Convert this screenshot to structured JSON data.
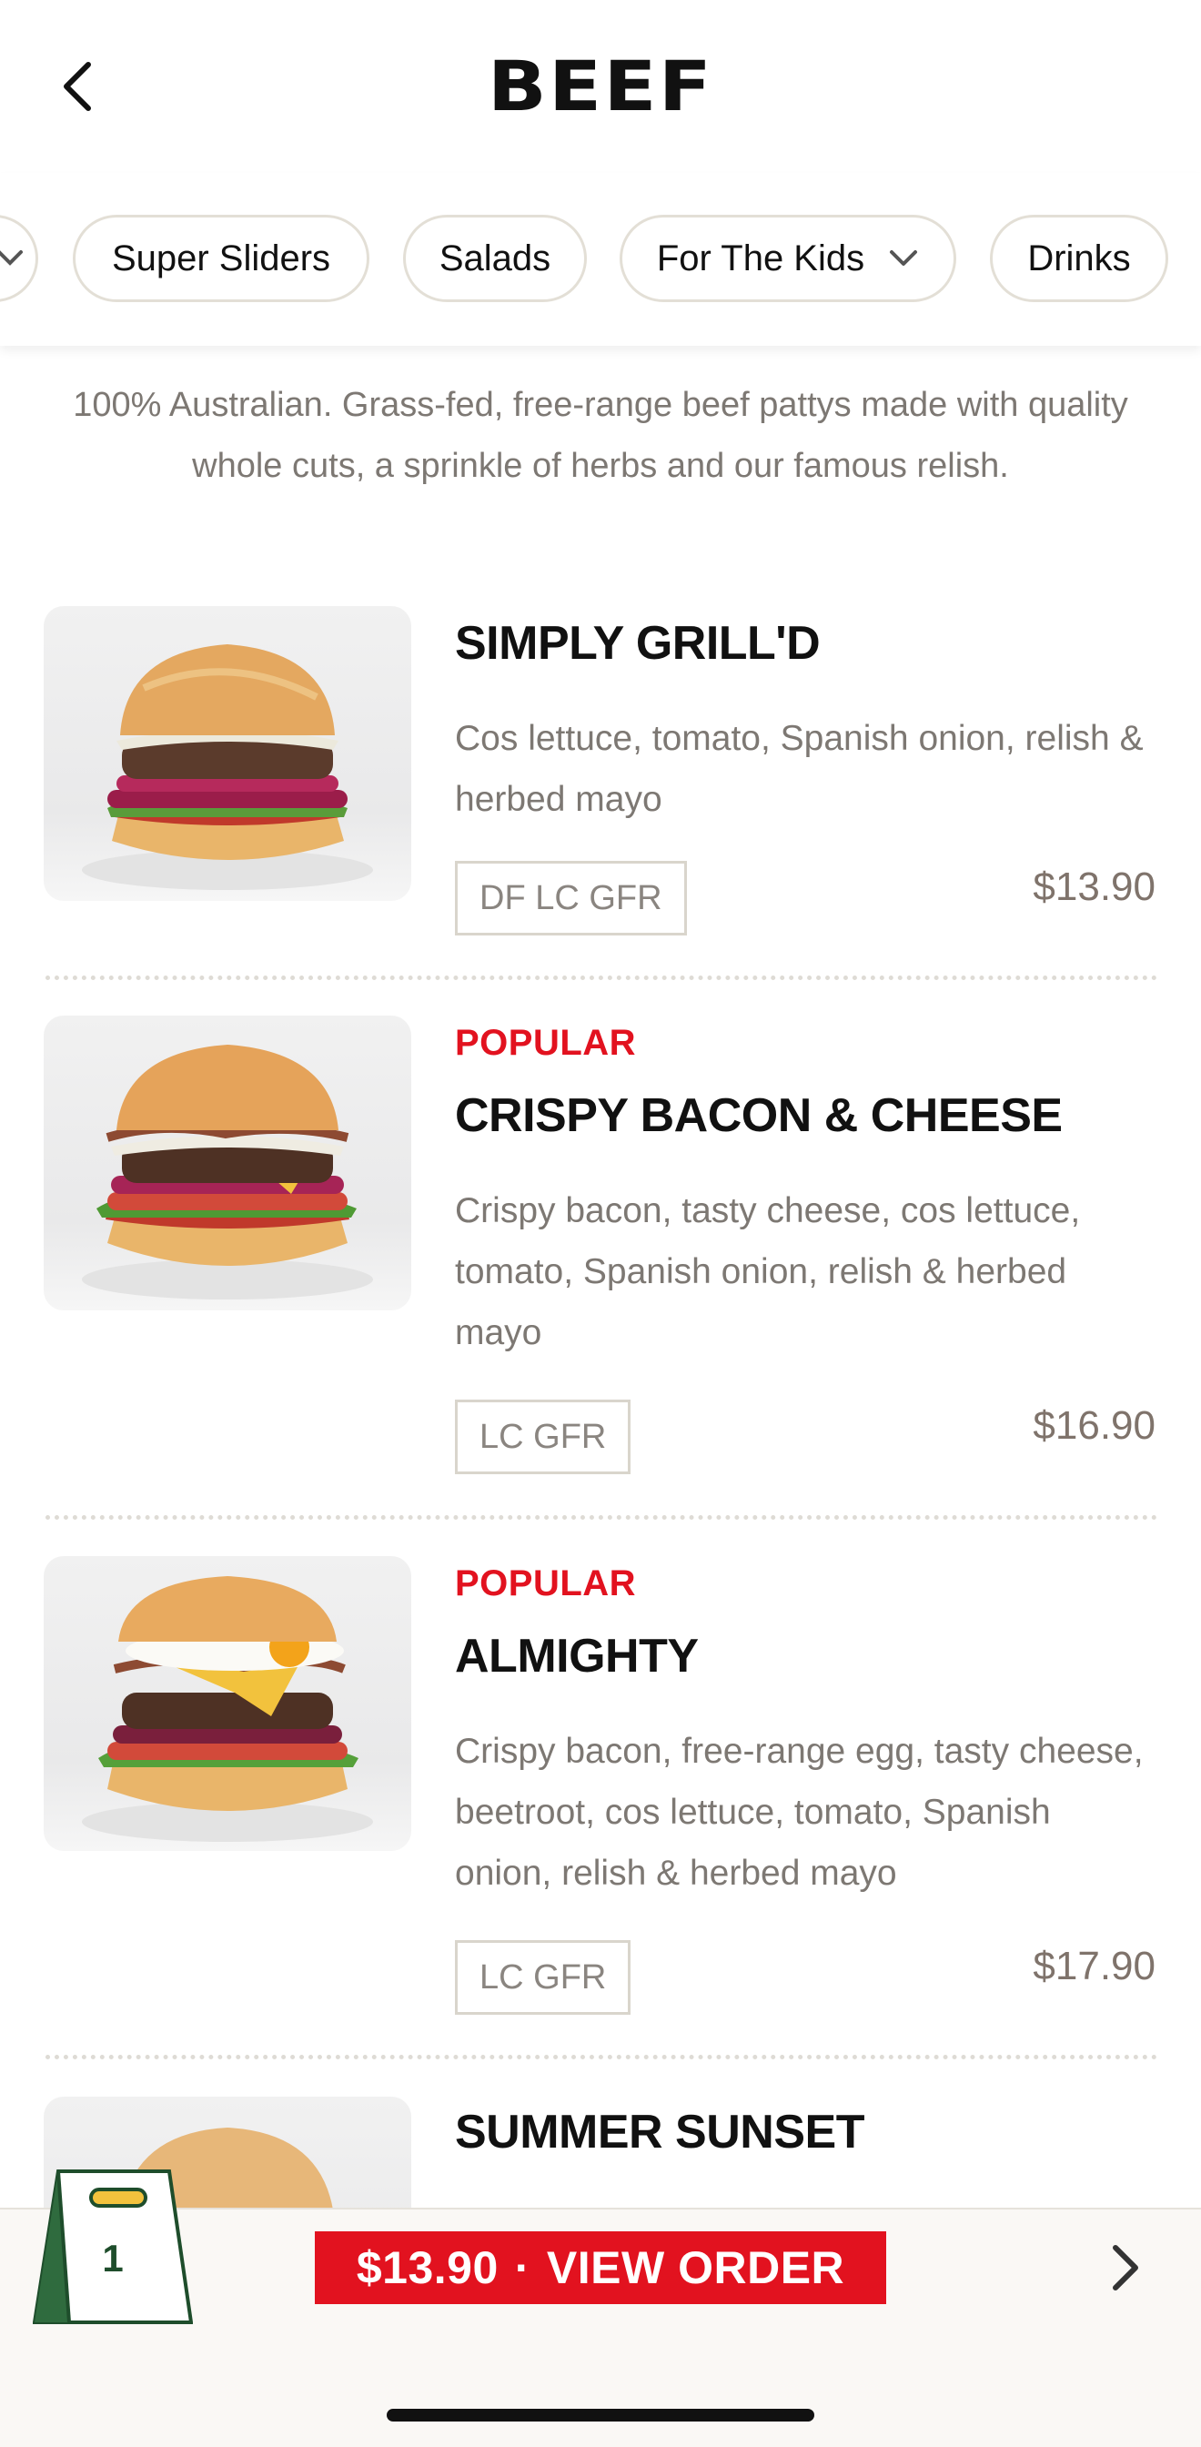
{
  "header": {
    "title": "BEEF",
    "back_icon": "chevron-left-icon"
  },
  "categories": [
    {
      "label": "",
      "has_chevron": true
    },
    {
      "label": "Super Sliders"
    },
    {
      "label": "Salads"
    },
    {
      "label": "For The Kids",
      "has_chevron": true
    },
    {
      "label": "Drinks"
    }
  ],
  "intro": "100% Australian. Grass-fed, free-range beef pattys made with quality whole cuts, a sprinkle of herbs and our famous relish.",
  "items": [
    {
      "badge": "",
      "name": "SIMPLY GRILL'D",
      "description": "Cos lettuce, tomato, Spanish onion, relish & herbed mayo",
      "dietary": "DF LC GFR",
      "price": "$13.90"
    },
    {
      "badge": "POPULAR",
      "name": "CRISPY BACON & CHEESE",
      "description": "Crispy bacon, tasty cheese, cos lettuce, tomato, Spanish onion, relish & herbed mayo",
      "dietary": "LC GFR",
      "price": "$16.90"
    },
    {
      "badge": "POPULAR",
      "name": "ALMIGHTY",
      "description": "Crispy bacon, free-range egg, tasty cheese, beetroot, cos lettuce, tomato, Spanish onion, relish & herbed mayo",
      "dietary": "LC GFR",
      "price": "$17.90"
    },
    {
      "badge": "",
      "name": "SUMMER SUNSET",
      "description": "",
      "dietary": "",
      "price": ""
    }
  ],
  "order_bar": {
    "bag_count": "1",
    "total": "$13.90",
    "separator": "·",
    "label": "VIEW ORDER",
    "arrow_icon": "chevron-right-icon"
  },
  "colors": {
    "accent_red": "#e2121f",
    "muted_text": "#7d7873",
    "bag_green": "#1e4d2b"
  }
}
